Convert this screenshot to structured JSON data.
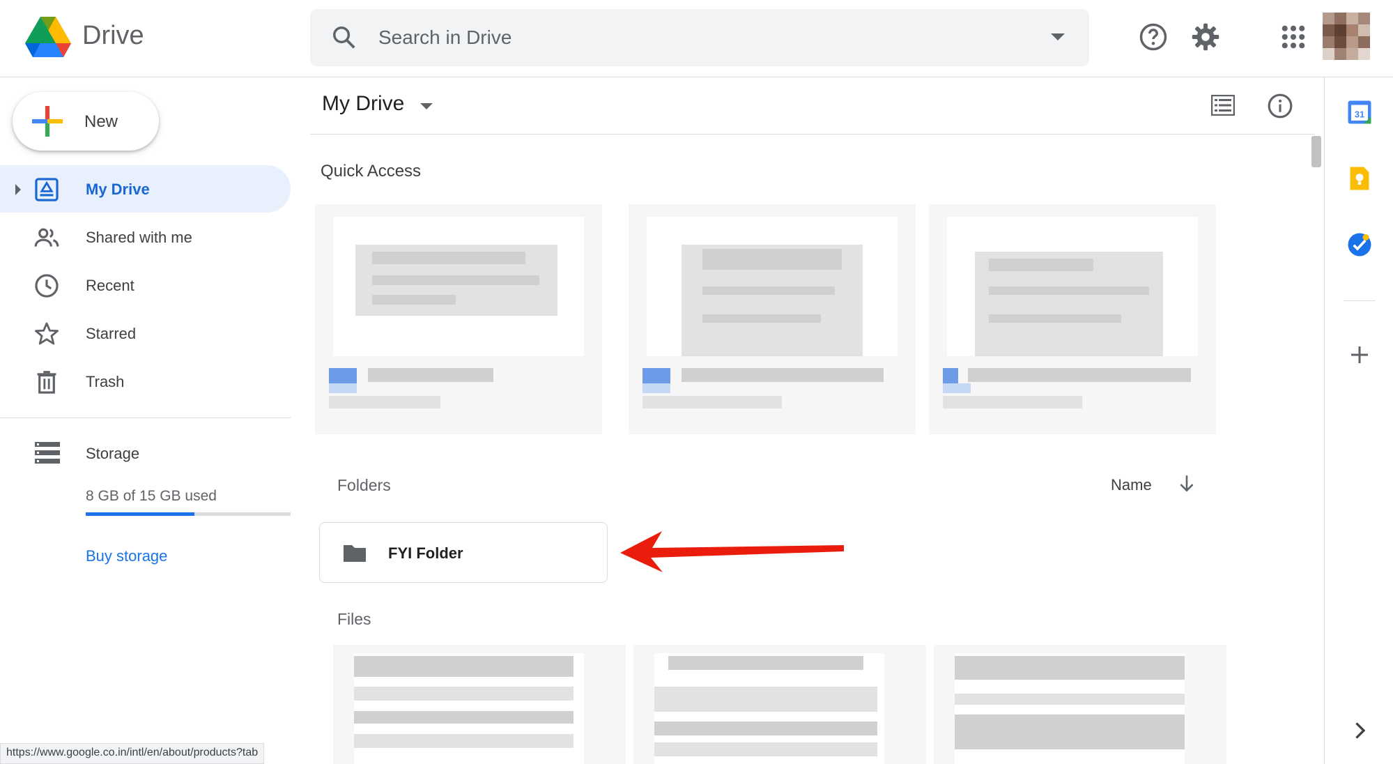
{
  "app": {
    "brand": "Drive"
  },
  "search": {
    "placeholder": "Search in Drive"
  },
  "header_icons": [
    "search-icon",
    "help-icon",
    "gear-icon",
    "apps-grid-icon",
    "avatar"
  ],
  "sidebar": {
    "new_button": "New",
    "items": [
      {
        "label": "My Drive",
        "icon": "my-drive-icon",
        "active": true
      },
      {
        "label": "Shared with me",
        "icon": "people-icon",
        "active": false
      },
      {
        "label": "Recent",
        "icon": "clock-icon",
        "active": false
      },
      {
        "label": "Starred",
        "icon": "star-icon",
        "active": false
      },
      {
        "label": "Trash",
        "icon": "trash-icon",
        "active": false
      }
    ],
    "storage": {
      "label": "Storage",
      "used_text": "8 GB of 15 GB used",
      "used_fraction": 0.53,
      "buy_label": "Buy storage"
    }
  },
  "main": {
    "title": "My Drive",
    "quick_access_title": "Quick Access",
    "folders_title": "Folders",
    "sort_label": "Name",
    "folders": [
      {
        "name": "FYI Folder"
      }
    ],
    "files_title": "Files"
  },
  "right_panel_icons": [
    "calendar-icon",
    "keep-icon",
    "tasks-icon",
    "add-icon",
    "expand-panel-icon"
  ],
  "status_bar": {
    "url": "https://www.google.co.in/intl/en/about/products?tab"
  },
  "colors": {
    "accent": "#1a73e8",
    "active_bg": "#e8f0fe",
    "active_text": "#1967d2",
    "annotation_arrow": "#ea1d0c"
  }
}
